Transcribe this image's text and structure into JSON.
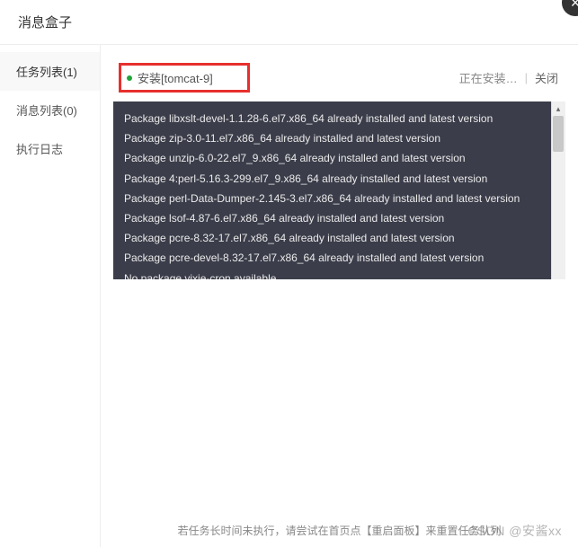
{
  "header": {
    "title": "消息盒子"
  },
  "sidebar": {
    "items": [
      {
        "label": "任务列表(1)",
        "active": true
      },
      {
        "label": "消息列表(0)",
        "active": false
      },
      {
        "label": "执行日志",
        "active": false
      }
    ]
  },
  "task": {
    "name": "安装[tomcat-9]",
    "status_text": "正在安装…",
    "close_label": "关闭",
    "status_color": "#20a53a"
  },
  "log_lines": [
    "Package libxslt-devel-1.1.28-6.el7.x86_64 already installed and latest version",
    "Package zip-3.0-11.el7.x86_64 already installed and latest version",
    "Package unzip-6.0-22.el7_9.x86_64 already installed and latest version",
    "Package 4:perl-5.16.3-299.el7_9.x86_64 already installed and latest version",
    "Package perl-Data-Dumper-2.145-3.el7.x86_64 already installed and latest version",
    "Package lsof-4.87-6.el7.x86_64 already installed and latest version",
    "Package pcre-8.32-17.el7.x86_64 already installed and latest version",
    "Package pcre-devel-8.32-17.el7.x86_64 already installed and latest version",
    "No package vixie-cron available."
  ],
  "footer": {
    "hint": "若任务长时间未执行，请尝试在首页点【重启面板】来重置任务队列"
  },
  "watermark": "CSDN @安酱xx"
}
